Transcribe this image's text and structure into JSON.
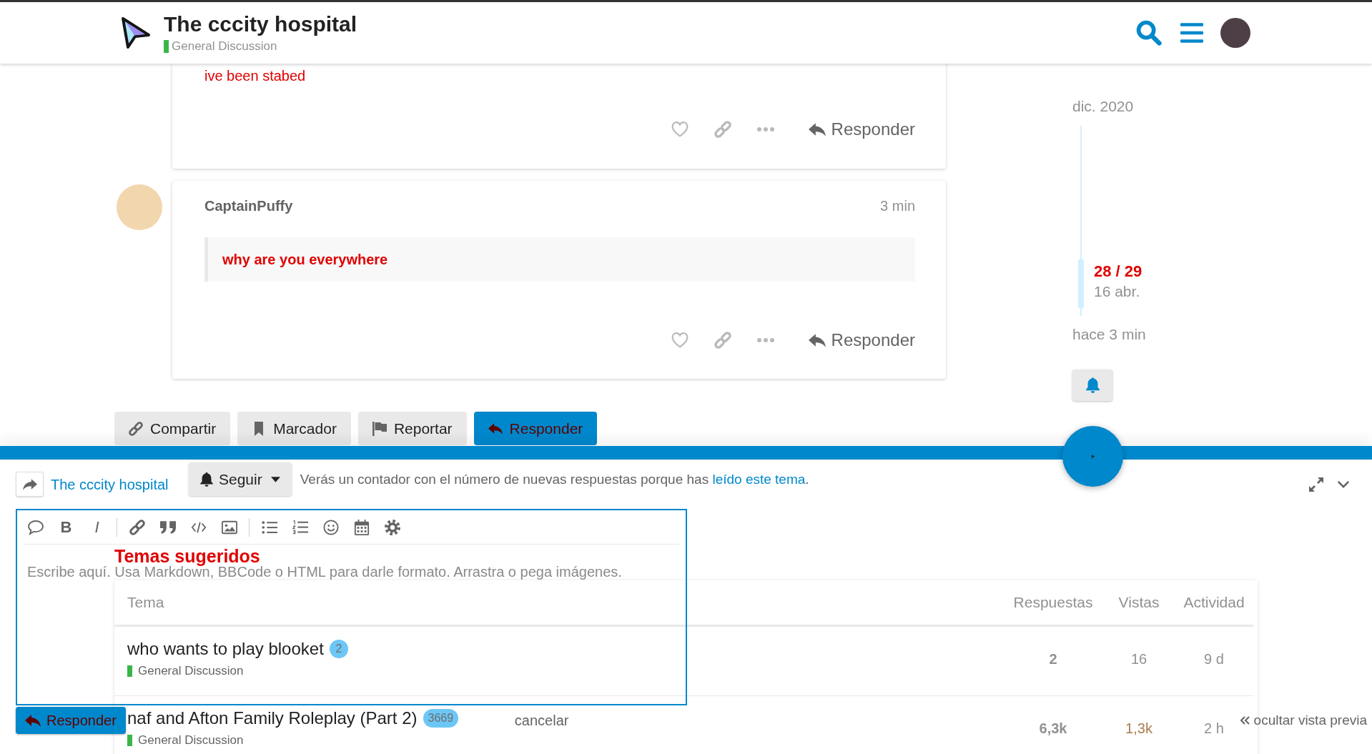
{
  "header": {
    "title": "The cccity hospital",
    "category": "General Discussion"
  },
  "posts": [
    {
      "body": [
        {
          "kind": "paragraph",
          "text": "ive been stabed"
        }
      ],
      "reply_label": "Responder"
    },
    {
      "author": "CaptainPuffy",
      "time": "3 min",
      "body": [
        {
          "kind": "quote",
          "text": "why are you everywhere"
        }
      ],
      "reply_label": "Responder"
    }
  ],
  "timeline": {
    "start": "dic. 2020",
    "position": "28 / 29",
    "position_date": "16 abr.",
    "end": "hace 3 min"
  },
  "footer_buttons": [
    {
      "kind": "share",
      "label": "Compartir",
      "primary": false
    },
    {
      "kind": "bookmark",
      "label": "Marcador",
      "primary": false
    },
    {
      "kind": "flag",
      "label": "Reportar",
      "primary": false
    },
    {
      "kind": "reply",
      "label": "Responder",
      "primary": true
    }
  ],
  "notifications": {
    "level": "Seguir",
    "message": "Verás un contador con el número de nuevas respuestas porque has",
    "link": "leído este tema",
    "message_end": "."
  },
  "suggested": {
    "title": "Temas sugeridos",
    "columns": [
      "Tema",
      "Respuestas",
      "Vistas",
      "Actividad"
    ],
    "rows": [
      {
        "title": "who wants to play blooket",
        "badge": "2",
        "category": "General Discussion",
        "replies": "2",
        "views": {
          "text": "16",
          "color": "#919191"
        },
        "activity": "9 d"
      },
      {
        "title": "naf and Afton Family Roleplay (Part 2)",
        "badge": "3669",
        "category": "General Discussion",
        "replies": "6,3k",
        "views": {
          "text": "1,3k",
          "color": "#a87d4e"
        },
        "activity": "2 h"
      }
    ]
  },
  "composer": {
    "topic_link": "The cccity hospital",
    "bold_glyph": "B",
    "italic_glyph": "I",
    "placeholder": "Escribe aquí. Usa Markdown, BBCode o HTML para darle formato. Arrastra o pega imágenes.",
    "submit": "Responder",
    "cancel": "cancelar",
    "preview_toggle": "ocultar vista previa"
  }
}
